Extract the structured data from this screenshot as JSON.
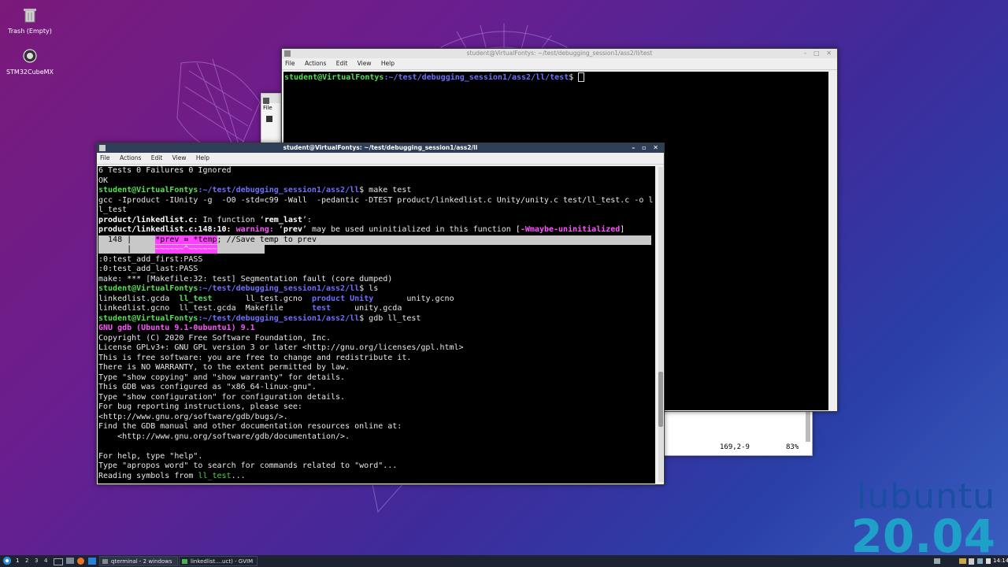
{
  "desktop": {
    "icons": [
      {
        "label": "Trash (Empty)",
        "icon": "trash-icon"
      },
      {
        "label": "STM32CubeMX",
        "icon": "gear-icon"
      }
    ],
    "branding": {
      "word": "lubuntu",
      "version": "20.04"
    }
  },
  "back_terminal": {
    "title": "student@VirtualFontys: ~/test/debugging_session1/ass2/ll/test",
    "menu": [
      "File",
      "Actions",
      "Edit",
      "View",
      "Help"
    ],
    "prompt_user": "student@VirtualFontys",
    "prompt_path": ":~/test/debugging_session1/ass2/ll/test",
    "prompt_symbol": "$"
  },
  "mini_window": {
    "menu": "File"
  },
  "gvim_status": {
    "position": "169,2-9",
    "percent": "83%"
  },
  "front_terminal": {
    "title": "student@VirtualFontys: ~/test/debugging_session1/ass2/ll",
    "menu": [
      "File",
      "Actions",
      "Edit",
      "View",
      "Help"
    ],
    "lines": {
      "l1": "6 Tests 0 Failures 0 Ignored",
      "l2": "OK",
      "p_user": "student@VirtualFontys",
      "p_path": ":~/test/debugging_session1/ass2/ll",
      "l3_cmd": "$ make test",
      "l4": "gcc -Iproduct -IUnity -g  -O0 -std=c99 -Wall  -pedantic -DTEST product/linkedlist.c Unity/unity.c test/ll_test.c -o l",
      "l5": "l_test",
      "l6_file": "product/linkedlist.c:",
      "l6_mid": " In function ‘",
      "l6_fn": "rem_last",
      "l6_end": "’:",
      "l7_loc": "product/linkedlist.c:148:10:",
      "l7_warn": " warning:",
      "l7_mid": " ‘",
      "l7_var": "prev",
      "l7_rest": "’ may be used uninitialized in this function [",
      "l7_flag": "-Wmaybe-uninitialized",
      "l7_close": "]",
      "l8_num": "  148 |",
      "l8_hl": "*prev = *temp",
      "l8_rest": "; //Save temp to prev",
      "l9_gut": "      |     ",
      "l9_caret": "~~~~~~^~~~~~~",
      "l10": ":0:test_add_first:PASS",
      "l11": ":0:test_add_last:PASS",
      "l12": "make: *** [Makefile:32: test] Segmentation fault (core dumped)",
      "l13_cmd": "$ ls",
      "l14_a": "linkedlist.gcda  ",
      "l14_b": "ll_test",
      "l14_c": "       ll_test.gcno  ",
      "l14_d": "product",
      "l14_e": "Unity",
      "l14_f": "       unity.gcno",
      "l15_a": "linkedlist.gcno  ll_test.gcda  Makefile      ",
      "l15_b": "test",
      "l15_c": "     unity.gcda",
      "l16_cmd": "$ gdb ll_test",
      "l17": "GNU gdb (Ubuntu 9.1-0ubuntu1) 9.1",
      "l18": "Copyright (C) 2020 Free Software Foundation, Inc.",
      "l19": "License GPLv3+: GNU GPL version 3 or later <http://gnu.org/licenses/gpl.html>",
      "l20": "This is free software: you are free to change and redistribute it.",
      "l21": "There is NO WARRANTY, to the extent permitted by law.",
      "l22": "Type \"show copying\" and \"show warranty\" for details.",
      "l23": "This GDB was configured as \"x86_64-linux-gnu\".",
      "l24": "Type \"show configuration\" for configuration details.",
      "l25": "For bug reporting instructions, please see:",
      "l26": "<http://www.gnu.org/software/gdb/bugs/>.",
      "l27": "Find the GDB manual and other documentation resources online at:",
      "l28": "    <http://www.gnu.org/software/gdb/documentation/>.",
      "l29": "",
      "l30": "For help, type \"help\".",
      "l31": "Type \"apropos word\" to search for commands related to \"word\"...",
      "l32_a": "Reading symbols from ",
      "l32_b": "ll_test",
      "l32_c": "..."
    }
  },
  "taskbar": {
    "workspaces": [
      "1",
      "2",
      "3",
      "4"
    ],
    "tasks": [
      {
        "label": "qterminal - 2 windows"
      },
      {
        "label": "linkedlist....uct) - GVIM"
      }
    ],
    "clock": "14:14"
  },
  "colors": {
    "prompt_green": "#55e055",
    "path_blue": "#6f6fff",
    "warning_magenta": "#ff55ff",
    "active_titlebar": "#2f3e57"
  }
}
